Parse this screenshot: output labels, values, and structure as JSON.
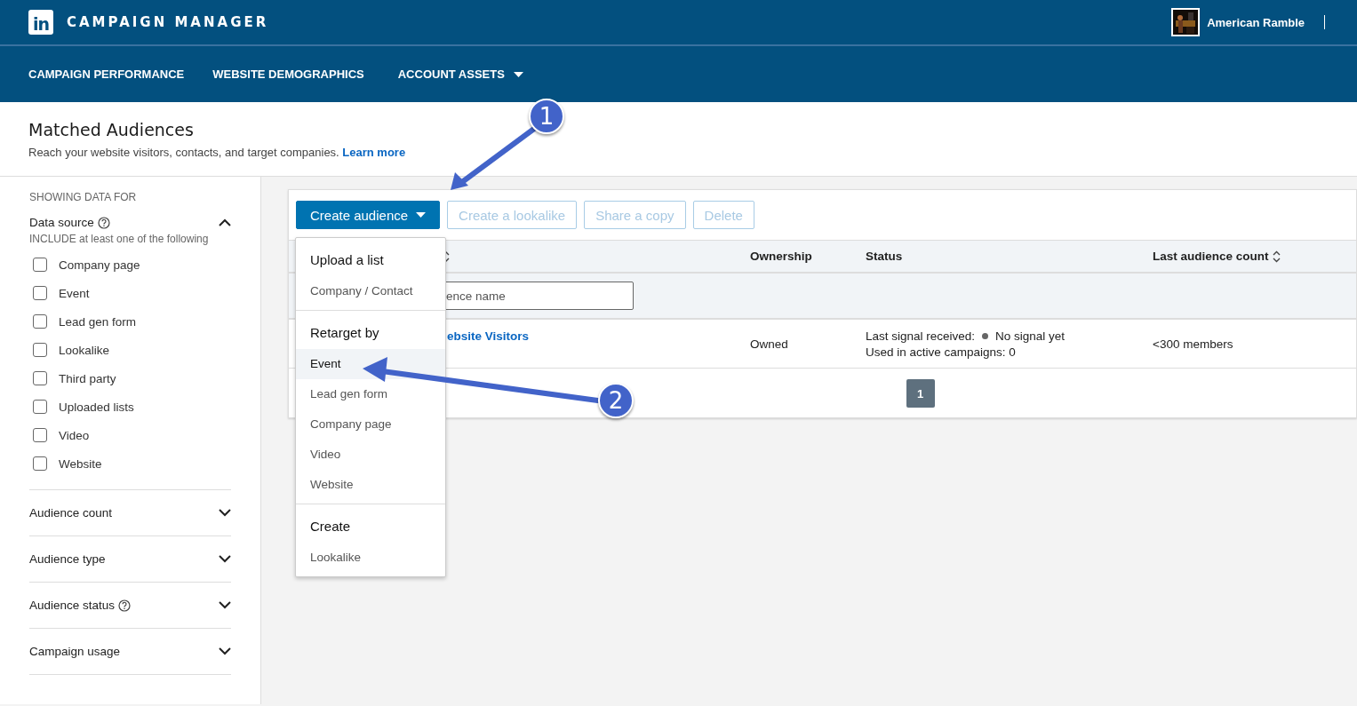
{
  "header": {
    "logo": "in",
    "product": "CAMPAIGN MANAGER",
    "account": "American Ramble"
  },
  "nav": [
    {
      "label": "CAMPAIGN PERFORMANCE",
      "dropdown": false
    },
    {
      "label": "WEBSITE DEMOGRAPHICS",
      "dropdown": false
    },
    {
      "label": "ACCOUNT ASSETS",
      "dropdown": true
    }
  ],
  "page": {
    "title": "Matched Audiences",
    "subtitle": "Reach your website visitors, contacts, and target companies.",
    "link": "Learn more"
  },
  "sidebar": {
    "heading": "SHOWING DATA FOR",
    "sections": [
      {
        "label": "Data source",
        "help": true,
        "expanded": true,
        "hint": "INCLUDE at least one of the following",
        "options": [
          {
            "label": "Company page",
            "checked": false
          },
          {
            "label": "Event",
            "checked": false
          },
          {
            "label": "Lead gen form",
            "checked": false
          },
          {
            "label": "Lookalike",
            "checked": false
          },
          {
            "label": "Third party",
            "checked": false
          },
          {
            "label": "Uploaded lists",
            "checked": false
          },
          {
            "label": "Video",
            "checked": false
          },
          {
            "label": "Website",
            "checked": false
          }
        ]
      },
      {
        "label": "Audience count",
        "help": false,
        "expanded": false
      },
      {
        "label": "Audience type",
        "help": false,
        "expanded": false
      },
      {
        "label": "Audience status",
        "help": true,
        "expanded": false
      },
      {
        "label": "Campaign usage",
        "help": false,
        "expanded": false
      }
    ]
  },
  "toolbar": [
    {
      "label": "Create audience",
      "kind": "primary",
      "disabled": false
    },
    {
      "label": "Create a lookalike",
      "kind": "secondary",
      "disabled": true
    },
    {
      "label": "Share a copy",
      "kind": "secondary",
      "disabled": true
    },
    {
      "label": "Delete",
      "kind": "secondary",
      "disabled": true
    }
  ],
  "menu": [
    {
      "heading": "Upload a list",
      "items": [
        {
          "label": "Company / Contact",
          "selected": false
        }
      ]
    },
    {
      "heading": "Retarget by",
      "items": [
        {
          "label": "Event",
          "selected": true
        },
        {
          "label": "Lead gen form",
          "selected": false
        },
        {
          "label": "Company page",
          "selected": false
        },
        {
          "label": "Video",
          "selected": false
        },
        {
          "label": "Website",
          "selected": false
        }
      ]
    },
    {
      "heading": "Create",
      "items": [
        {
          "label": "Lookalike",
          "selected": false
        }
      ]
    }
  ],
  "table": {
    "columns": [
      {
        "sortable": true
      },
      {
        "label": "Ownership",
        "sortable": false
      },
      {
        "label": "Status",
        "sortable": false
      },
      {
        "label": "Last audience count",
        "sortable": true
      }
    ],
    "filter": {
      "placeholder": "ence name"
    },
    "rows": [
      {
        "name": "ebsite Visitors",
        "ownership": "Owned",
        "signal_label": "Last signal received:",
        "signal_value": "No signal yet",
        "campaigns": "Used in active campaigns: 0",
        "count_symbol": "<",
        "count": "300 members"
      }
    ],
    "pages": [
      {
        "label": "1",
        "selected": true
      }
    ]
  },
  "annotations": [
    {
      "label": "1"
    },
    {
      "label": "2"
    }
  ]
}
